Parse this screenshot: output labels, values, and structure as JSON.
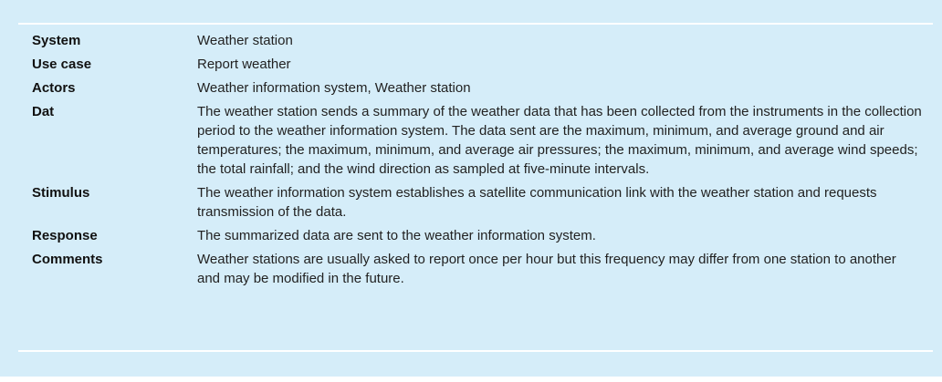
{
  "rows": [
    {
      "label": "System",
      "value": "Weather station"
    },
    {
      "label": "Use case",
      "value": "Report weather"
    },
    {
      "label": "Actors",
      "value": "Weather information system, Weather station"
    },
    {
      "label": "Dat",
      "value": "The weather station sends a summary of the weather data that has been collected from the instruments in the collection period to the weather information system. The data sent are the maximum, minimum, and average ground and air temperatures; the maximum, minimum, and average air pressures; the maximum, minimum, and average wind speeds; the total rainfall; and the wind direction as sampled at five-minute intervals."
    },
    {
      "label": "Stimulus",
      "value": "The weather information system establishes a satellite communication link with the weather station and requests transmission of the data."
    },
    {
      "label": "Response",
      "value": "The summarized data are sent to the weather information system."
    },
    {
      "label": "Comments",
      "value": "Weather stations are usually asked to report once per hour but this frequency may differ from one station to another and may be modified in the future."
    }
  ]
}
